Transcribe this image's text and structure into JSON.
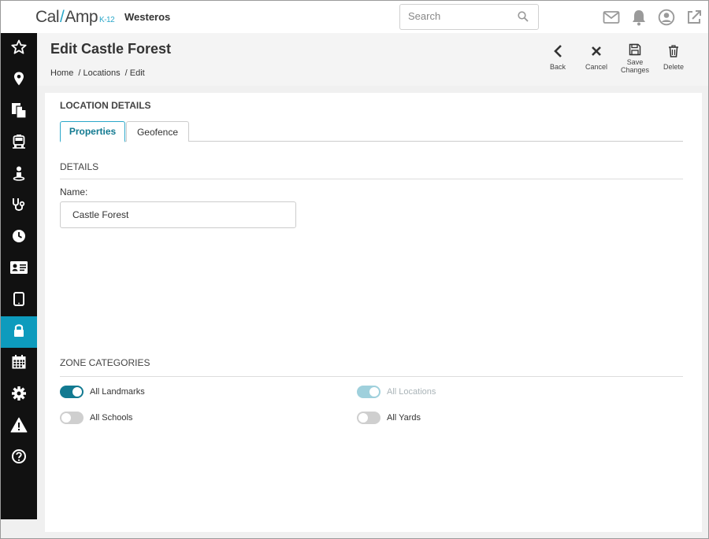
{
  "app": {
    "logo_main": "Cal",
    "logo_second": "Amp",
    "logo_sub": "K-12",
    "org_name": "Westeros"
  },
  "search": {
    "placeholder": "Search"
  },
  "header": {
    "title": "Edit Castle Forest",
    "breadcrumbs": [
      "Home",
      "/ Locations",
      "/ Edit"
    ],
    "actions": {
      "back": "Back",
      "cancel": "Cancel",
      "save_line1": "Save",
      "save_line2": "Changes",
      "delete": "Delete"
    }
  },
  "sidebar": {
    "items": [
      {
        "icon": "star-icon"
      },
      {
        "icon": "map-pin-icon"
      },
      {
        "icon": "documents-icon"
      },
      {
        "icon": "bus-icon"
      },
      {
        "icon": "person-icon"
      },
      {
        "icon": "stethoscope-icon"
      },
      {
        "icon": "clock-icon"
      },
      {
        "icon": "id-card-icon"
      },
      {
        "icon": "tablet-icon"
      },
      {
        "icon": "lock-icon",
        "active": true
      },
      {
        "icon": "calendar-icon"
      },
      {
        "icon": "gear-icon"
      },
      {
        "icon": "warning-icon"
      },
      {
        "icon": "help-icon"
      }
    ]
  },
  "location": {
    "section_title": "LOCATION DETAILS",
    "tabs": [
      {
        "label": "Properties",
        "active": true
      },
      {
        "label": "Geofence",
        "active": false
      }
    ],
    "details_title": "DETAILS",
    "name_label": "Name:",
    "name_value": "Castle Forest",
    "zone_title": "ZONE CATEGORIES",
    "zones": [
      {
        "label": "All Landmarks",
        "on": true,
        "disabled": false
      },
      {
        "label": "All Locations",
        "on": true,
        "disabled": true
      },
      {
        "label": "All Schools",
        "on": false,
        "disabled": false
      },
      {
        "label": "All Yards",
        "on": false,
        "disabled": false
      }
    ]
  },
  "colors": {
    "accent": "#0d9bbd",
    "toggle_on": "#127a91",
    "sidebar_bg": "#111111"
  }
}
